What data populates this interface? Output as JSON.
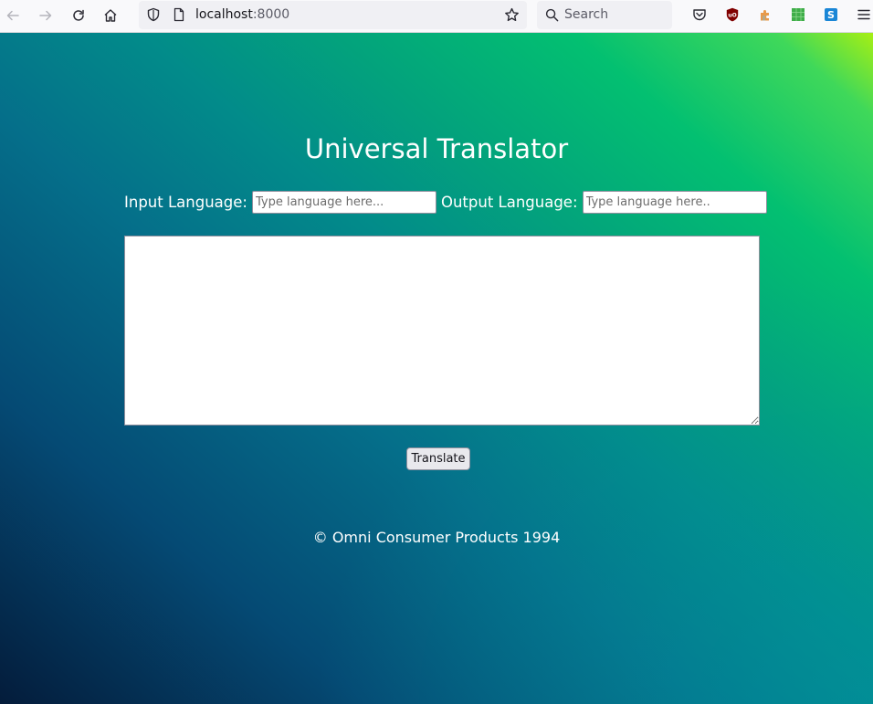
{
  "browser": {
    "url_host": "localhost",
    "url_port": ":8000",
    "search_placeholder": "Search",
    "icons": [
      "back-icon",
      "forward-icon",
      "reload-icon",
      "home-icon",
      "shield-icon",
      "page-icon",
      "bookmark-star-icon",
      "search-icon",
      "pocket-icon",
      "ublock-icon",
      "extension-icon",
      "sheets-extension-icon",
      "s-extension-icon",
      "menu-icon"
    ]
  },
  "page": {
    "title": "Universal Translator",
    "input_language_label": "Input Language:",
    "input_language_placeholder": "Type language here...",
    "input_language_value": "",
    "output_language_label": "Output Language:",
    "output_language_placeholder": "Type language here..",
    "output_language_value": "",
    "text_value": "",
    "translate_label": "Translate",
    "footer": "© Omni Consumer Products 1994"
  },
  "colors": {
    "gradient_top_right": "#a6ef14",
    "gradient_mid": "#03c071",
    "gradient_bottom_left": "#041c3b",
    "text": "#ffffff"
  }
}
